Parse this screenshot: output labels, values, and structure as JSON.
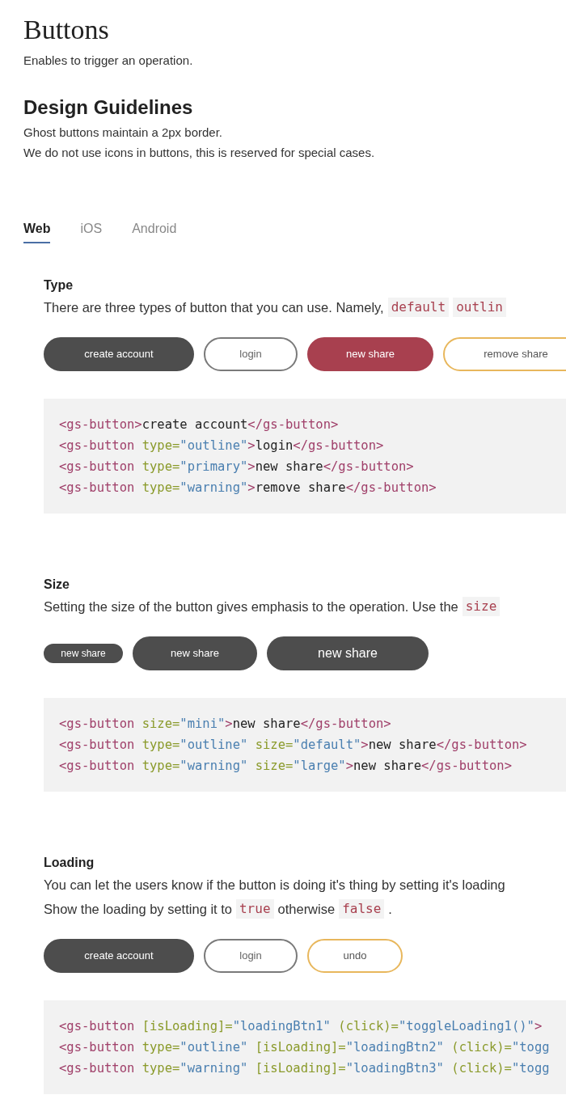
{
  "page": {
    "title": "Buttons",
    "subtitle": "Enables to trigger an operation."
  },
  "guidelines": {
    "heading": "Design Guidelines",
    "lines": [
      "Ghost buttons maintain a 2px border.",
      "We do not use icons in buttons, this is reserved for special cases."
    ]
  },
  "tabs": [
    {
      "label": "Web",
      "selected": true
    },
    {
      "label": "iOS",
      "selected": false
    },
    {
      "label": "Android",
      "selected": false
    }
  ],
  "sections": [
    {
      "title": "Type",
      "description": [
        [
          {
            "kind": "text",
            "text": "There are three types of button that you can use. Namely,"
          },
          {
            "kind": "code",
            "text": "default"
          },
          {
            "kind": "code",
            "text": "outlin"
          }
        ]
      ],
      "buttons": [
        {
          "label": "create account",
          "kind": "solid"
        },
        {
          "label": "login",
          "kind": "outline"
        },
        {
          "label": "new share",
          "kind": "primary"
        },
        {
          "label": "remove share",
          "kind": "warning"
        }
      ],
      "code": [
        [
          {
            "kind": "tag",
            "text": "<gs-button>"
          },
          {
            "kind": "text",
            "text": "create account"
          },
          {
            "kind": "tag",
            "text": "</gs-button>"
          }
        ],
        [
          {
            "kind": "tag",
            "text": "<gs-button "
          },
          {
            "kind": "attr",
            "text": "type="
          },
          {
            "kind": "str",
            "text": "\"outline\""
          },
          {
            "kind": "tag",
            "text": ">"
          },
          {
            "kind": "text",
            "text": "login"
          },
          {
            "kind": "tag",
            "text": "</gs-button>"
          }
        ],
        [
          {
            "kind": "tag",
            "text": "<gs-button "
          },
          {
            "kind": "attr",
            "text": "type="
          },
          {
            "kind": "str",
            "text": "\"primary\""
          },
          {
            "kind": "tag",
            "text": ">"
          },
          {
            "kind": "text",
            "text": "new share"
          },
          {
            "kind": "tag",
            "text": "</gs-button>"
          }
        ],
        [
          {
            "kind": "tag",
            "text": "<gs-button "
          },
          {
            "kind": "attr",
            "text": "type="
          },
          {
            "kind": "str",
            "text": "\"warning\""
          },
          {
            "kind": "tag",
            "text": ">"
          },
          {
            "kind": "text",
            "text": "remove share"
          },
          {
            "kind": "tag",
            "text": "</gs-button>"
          }
        ]
      ]
    },
    {
      "title": "Size",
      "description": [
        [
          {
            "kind": "text",
            "text": "Setting the size of the button gives emphasis to the operation. Use the"
          },
          {
            "kind": "code",
            "text": "size"
          }
        ]
      ],
      "buttons": [
        {
          "label": "new share",
          "kind": "mini"
        },
        {
          "label": "new share",
          "kind": "solid"
        },
        {
          "label": "new share",
          "kind": "large"
        }
      ],
      "code": [
        [
          {
            "kind": "tag",
            "text": "<gs-button "
          },
          {
            "kind": "attr",
            "text": "size="
          },
          {
            "kind": "str",
            "text": "\"mini\""
          },
          {
            "kind": "tag",
            "text": ">"
          },
          {
            "kind": "text",
            "text": "new share"
          },
          {
            "kind": "tag",
            "text": "</gs-button>"
          }
        ],
        [
          {
            "kind": "tag",
            "text": "<gs-button "
          },
          {
            "kind": "attr",
            "text": "type="
          },
          {
            "kind": "str",
            "text": "\"outline\" "
          },
          {
            "kind": "attr",
            "text": "size="
          },
          {
            "kind": "str",
            "text": "\"default\""
          },
          {
            "kind": "tag",
            "text": ">"
          },
          {
            "kind": "text",
            "text": "new share"
          },
          {
            "kind": "tag",
            "text": "</gs-button>"
          }
        ],
        [
          {
            "kind": "tag",
            "text": "<gs-button "
          },
          {
            "kind": "attr",
            "text": "type="
          },
          {
            "kind": "str",
            "text": "\"warning\" "
          },
          {
            "kind": "attr",
            "text": "size="
          },
          {
            "kind": "str",
            "text": "\"large\""
          },
          {
            "kind": "tag",
            "text": ">"
          },
          {
            "kind": "text",
            "text": "new share"
          },
          {
            "kind": "tag",
            "text": "</gs-button>"
          }
        ]
      ]
    },
    {
      "title": "Loading",
      "description": [
        [
          {
            "kind": "text",
            "text": "You can let the users know if the button is doing it's thing by setting it's loading"
          }
        ],
        [
          {
            "kind": "text",
            "text": "Show the loading by setting it to"
          },
          {
            "kind": "code",
            "text": "true"
          },
          {
            "kind": "text",
            "text": "otherwise"
          },
          {
            "kind": "code",
            "text": "false"
          },
          {
            "kind": "text",
            "text": "."
          }
        ]
      ],
      "buttons": [
        {
          "label": "create account",
          "kind": "solid"
        },
        {
          "label": "login",
          "kind": "outline"
        },
        {
          "label": "undo",
          "kind": "warning"
        }
      ],
      "code": [
        [
          {
            "kind": "tag",
            "text": "<gs-button "
          },
          {
            "kind": "attr",
            "text": "[isLoading]="
          },
          {
            "kind": "str",
            "text": "\"loadingBtn1\" "
          },
          {
            "kind": "attr",
            "text": "(click)="
          },
          {
            "kind": "str",
            "text": "\"toggleLoading1()\""
          },
          {
            "kind": "tag",
            "text": ">"
          }
        ],
        [
          {
            "kind": "tag",
            "text": "<gs-button "
          },
          {
            "kind": "attr",
            "text": "type="
          },
          {
            "kind": "str",
            "text": "\"outline\" "
          },
          {
            "kind": "attr",
            "text": "[isLoading]="
          },
          {
            "kind": "str",
            "text": "\"loadingBtn2\" "
          },
          {
            "kind": "attr",
            "text": "(click)="
          },
          {
            "kind": "str",
            "text": "\"togg"
          }
        ],
        [
          {
            "kind": "tag",
            "text": "<gs-button "
          },
          {
            "kind": "attr",
            "text": "type="
          },
          {
            "kind": "str",
            "text": "\"warning\" "
          },
          {
            "kind": "attr",
            "text": "[isLoading]="
          },
          {
            "kind": "str",
            "text": "\"loadingBtn3\" "
          },
          {
            "kind": "attr",
            "text": "(click)="
          },
          {
            "kind": "str",
            "text": "\"togg"
          }
        ]
      ]
    }
  ]
}
